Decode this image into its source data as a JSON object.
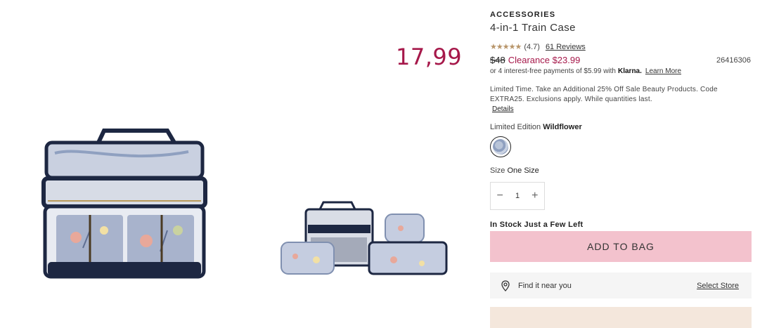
{
  "overlay_price": "17,99",
  "product": {
    "category": "ACCESSORIES",
    "title": "4-in-1 Train Case",
    "stars": "★★★★★",
    "rating": "(4.7)",
    "reviews": "61 Reviews",
    "old_price": "$48",
    "clearance_price": "Clearance $23.99",
    "sku": "26416306",
    "klarna_text": "or 4 interest-free payments of $5.99 with",
    "klarna_brand": "Klarna.",
    "learn_more": "Learn More",
    "promo": "Limited Time. Take an Additional 25% Off Sale Beauty Products. Code EXTRA25. Exclusions apply. While quantities last.",
    "details_link": "Details",
    "edition_label": "Limited Edition",
    "edition_value": "Wildflower",
    "size_label": "Size",
    "size_value": "One Size",
    "qty_minus": "−",
    "qty_value": "1",
    "qty_plus": "+",
    "stock_text": "In Stock Just a Few Left",
    "add_to_bag": "ADD TO BAG",
    "find_label": "Find it near you",
    "select_store": "Select Store"
  },
  "colors": {
    "accent": "#a6184a",
    "add_button_bg": "#f3c2cd",
    "star": "#b8956a"
  },
  "icons": {
    "location": "location-pin-icon",
    "swatch": "wildflower-swatch"
  }
}
